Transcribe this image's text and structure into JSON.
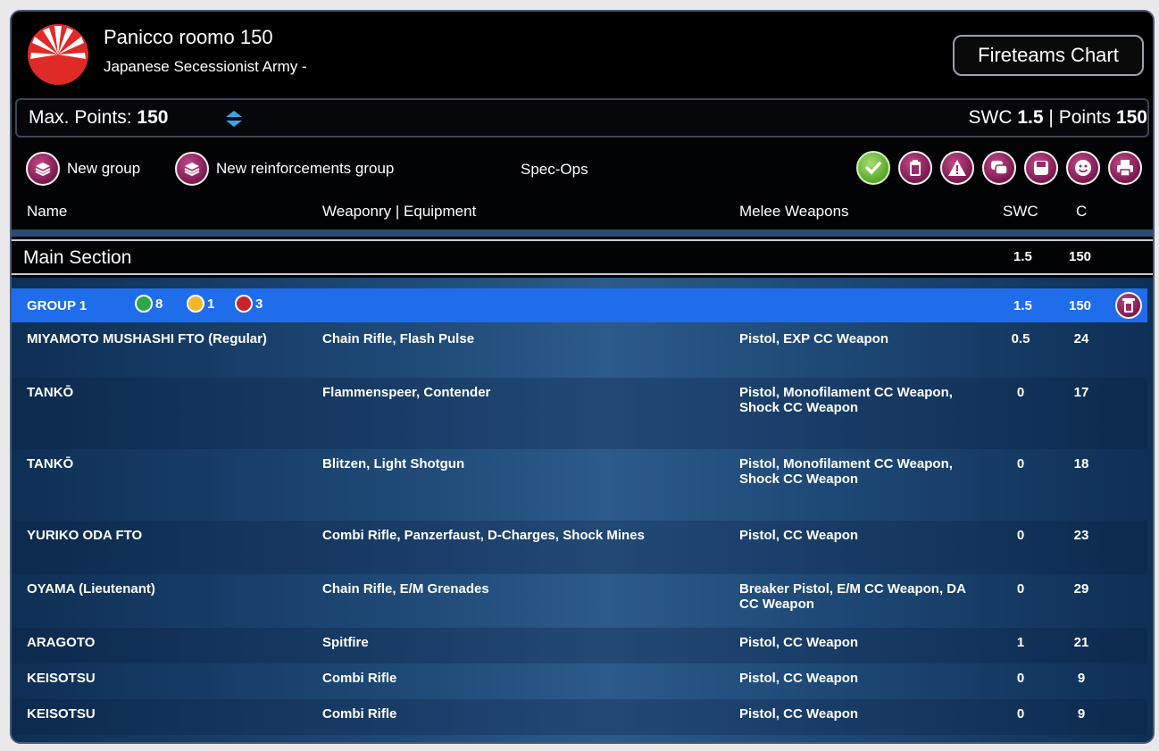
{
  "header": {
    "title": "Panicco roomo 150",
    "army": "Japanese Secessionist Army -",
    "fireteams_button": "Fireteams Chart"
  },
  "points_bar": {
    "max_label": "Max. Points:",
    "max_value": "150",
    "swc_label": "SWC",
    "swc_value": "1.5",
    "separator": "|",
    "points_label": "Points",
    "points_value": "150"
  },
  "toolbar": {
    "new_group": "New group",
    "new_reinforcements": "New reinforcements group",
    "spec_ops": "Spec-Ops",
    "icons": [
      "check-icon",
      "clipboard-icon",
      "warning-icon",
      "comments-icon",
      "save-icon",
      "smiley-icon",
      "print-icon"
    ]
  },
  "columns": {
    "name": "Name",
    "weaponry": "Weaponry | Equipment",
    "melee": "Melee Weapons",
    "swc": "SWC",
    "c": "C"
  },
  "main_section": {
    "label": "Main Section",
    "swc": "1.5",
    "points": "150"
  },
  "group": {
    "label": "GROUP 1",
    "regular_orders": "8",
    "impetuous_orders": "1",
    "irregular_orders": "3",
    "swc": "1.5",
    "points": "150"
  },
  "units": [
    {
      "name": "MIYAMOTO MUSHASHI FTO (Regular)",
      "weapons": "Chain Rifle, Flash Pulse",
      "melee": "Pistol, EXP CC Weapon",
      "swc": "0.5",
      "c": "24"
    },
    {
      "name": "TANKŌ",
      "weapons": "Flammenspeer, Contender",
      "melee": "Pistol, Monofilament CC Weapon, Shock CC Weapon",
      "swc": "0",
      "c": "17"
    },
    {
      "name": "TANKŌ",
      "weapons": "Blitzen, Light Shotgun",
      "melee": "Pistol, Monofilament CC Weapon, Shock CC Weapon",
      "swc": "0",
      "c": "18"
    },
    {
      "name": "YURIKO ODA FTO",
      "weapons": "Combi Rifle, Panzerfaust, D-Charges, Shock Mines",
      "melee": "Pistol, CC Weapon",
      "swc": "0",
      "c": "23"
    },
    {
      "name": "OYAMA (Lieutenant)",
      "weapons": "Chain Rifle, E/M Grenades",
      "melee": "Breaker Pistol, E/M CC Weapon, DA CC Weapon",
      "swc": "0",
      "c": "29"
    },
    {
      "name": "ARAGOTO",
      "weapons": "Spitfire",
      "melee": "Pistol, CC Weapon",
      "swc": "1",
      "c": "21"
    },
    {
      "name": "KEISOTSU",
      "weapons": "Combi Rifle",
      "melee": "Pistol, CC Weapon",
      "swc": "0",
      "c": "9"
    },
    {
      "name": "KEISOTSU",
      "weapons": "Combi Rifle",
      "melee": "Pistol, CC Weapon",
      "swc": "0",
      "c": "9"
    }
  ],
  "colors": {
    "group_bar": "#1f6dea",
    "badge_regular": "#2aa84a",
    "badge_impetuous": "#f1b82c",
    "badge_irregular": "#c8242c",
    "icon_magenta": "#9b2a67"
  }
}
